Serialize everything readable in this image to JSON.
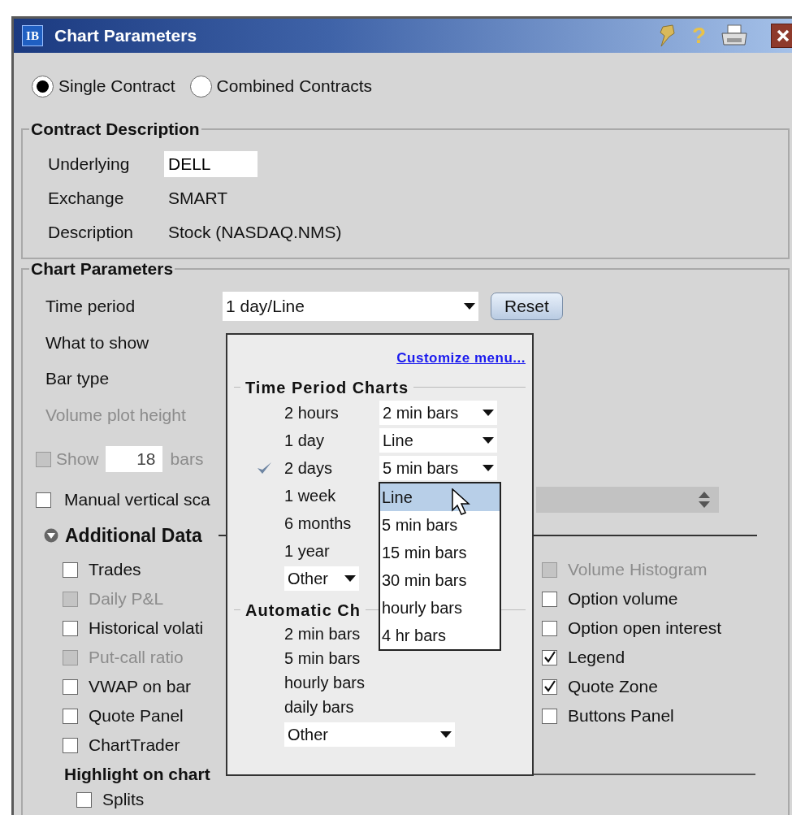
{
  "window": {
    "logo": "IB",
    "title": "Chart Parameters",
    "help_glyph": "?"
  },
  "contract_type": [
    {
      "label": "Single Contract",
      "selected": true
    },
    {
      "label": "Combined Contracts",
      "selected": false
    }
  ],
  "contract_description": {
    "title": "Contract Description",
    "rows": [
      {
        "label": "Underlying",
        "value": "DELL",
        "kind": "field"
      },
      {
        "label": "Exchange",
        "value": "SMART",
        "kind": "text"
      },
      {
        "label": "Description",
        "value": "Stock (NASDAQ.NMS)",
        "kind": "text"
      }
    ]
  },
  "chart_parameters": {
    "title": "Chart Parameters",
    "time_period": {
      "label": "Time period",
      "value": "1 day/Line",
      "reset": "Reset"
    },
    "labels": [
      {
        "label": "What to show",
        "disabled": false
      },
      {
        "label": "Bar type",
        "disabled": false
      },
      {
        "label": "Volume plot height",
        "disabled": true
      }
    ],
    "show_bars": {
      "label": "Show",
      "value": "18",
      "unit": "bars",
      "checked": false,
      "disabled": true
    },
    "manual_scale": {
      "label": "Manual vertical sca",
      "checked": false
    },
    "additional_data": {
      "title": "Additional Data",
      "left": [
        {
          "label": "Trades",
          "checked": false,
          "disabled": false
        },
        {
          "label": "Daily P&L",
          "checked": false,
          "disabled": true
        },
        {
          "label": "Historical volati",
          "checked": false,
          "disabled": false
        },
        {
          "label": "Put-call ratio",
          "checked": false,
          "disabled": true
        },
        {
          "label": "VWAP on bar",
          "checked": false,
          "disabled": false
        },
        {
          "label": "Quote Panel",
          "checked": false,
          "disabled": false
        },
        {
          "label": "ChartTrader",
          "checked": false,
          "disabled": false
        }
      ],
      "right": [
        {
          "label": "Volume Histogram",
          "checked": false,
          "disabled": true
        },
        {
          "label": "Option volume",
          "checked": false,
          "disabled": false
        },
        {
          "label": "Option open interest",
          "checked": false,
          "disabled": false
        },
        {
          "label": "Legend",
          "checked": true,
          "disabled": false
        },
        {
          "label": "Quote Zone",
          "checked": true,
          "disabled": false
        },
        {
          "label": "Buttons Panel",
          "checked": false,
          "disabled": false
        }
      ]
    },
    "highlight": {
      "title": "Highlight on chart",
      "items": [
        {
          "label": "Splits",
          "checked": false
        }
      ]
    }
  },
  "popup": {
    "link": "Customize menu...",
    "time_period_section": {
      "title": "Time Period Charts",
      "rows": [
        {
          "period": "2 hours",
          "bars": "2 min bars",
          "selected": false
        },
        {
          "period": "1 day",
          "bars": "Line",
          "selected": false
        },
        {
          "period": "2 days",
          "bars": "5 min bars",
          "selected": true
        },
        {
          "period": "1 week",
          "selected": false
        },
        {
          "period": "6 months",
          "selected": false
        },
        {
          "period": "1 year",
          "selected": false
        }
      ],
      "other": "Other"
    },
    "automatic_section": {
      "title": "Automatic Ch",
      "rows": [
        "2 min bars",
        "5 min bars",
        "hourly bars",
        "daily bars"
      ],
      "other": "Other"
    }
  },
  "bar_menu": {
    "items": [
      {
        "label": "Line",
        "selected": true
      },
      {
        "label": "5 min bars",
        "selected": false
      },
      {
        "label": "15 min bars",
        "selected": false
      },
      {
        "label": "30 min bars",
        "selected": false
      },
      {
        "label": "hourly bars",
        "selected": false
      },
      {
        "label": "4 hr bars",
        "selected": false
      }
    ]
  }
}
